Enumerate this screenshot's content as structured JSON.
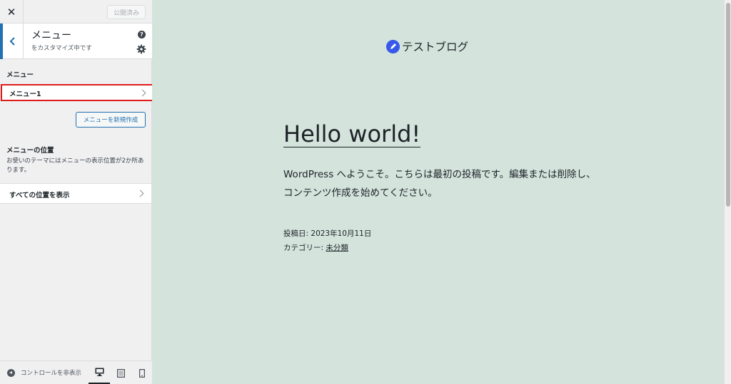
{
  "topbar": {
    "close_symbol": "✕",
    "publish_label": "公開済み"
  },
  "section": {
    "title": "メニュー",
    "subtitle": "をカスタマイズ中です",
    "help_symbol": "?"
  },
  "menus": {
    "heading": "メニュー",
    "items": [
      {
        "label": "メニュー1"
      }
    ],
    "new_menu_label": "メニューを新規作成"
  },
  "locations": {
    "heading": "メニューの位置",
    "description": "お使いのテーマにはメニューの表示位置が2か所あります。",
    "view_all_label": "すべての位置を表示"
  },
  "footer": {
    "collapse_label": "コントロールを非表示"
  },
  "preview": {
    "site_title": "テストブログ",
    "post_title": "Hello world!",
    "post_body": "WordPress へようこそ。こちらは最初の投稿です。編集または削除し、コンテンツ作成を始めてください。",
    "meta_date_label": "投稿日: ",
    "meta_date": "2023年10月11日",
    "meta_category_label": "カテゴリー: ",
    "meta_category": "未分類"
  },
  "colors": {
    "accent": "#2271b1",
    "highlight": "#e01b1b",
    "preview_bg": "#d4e3dc"
  }
}
